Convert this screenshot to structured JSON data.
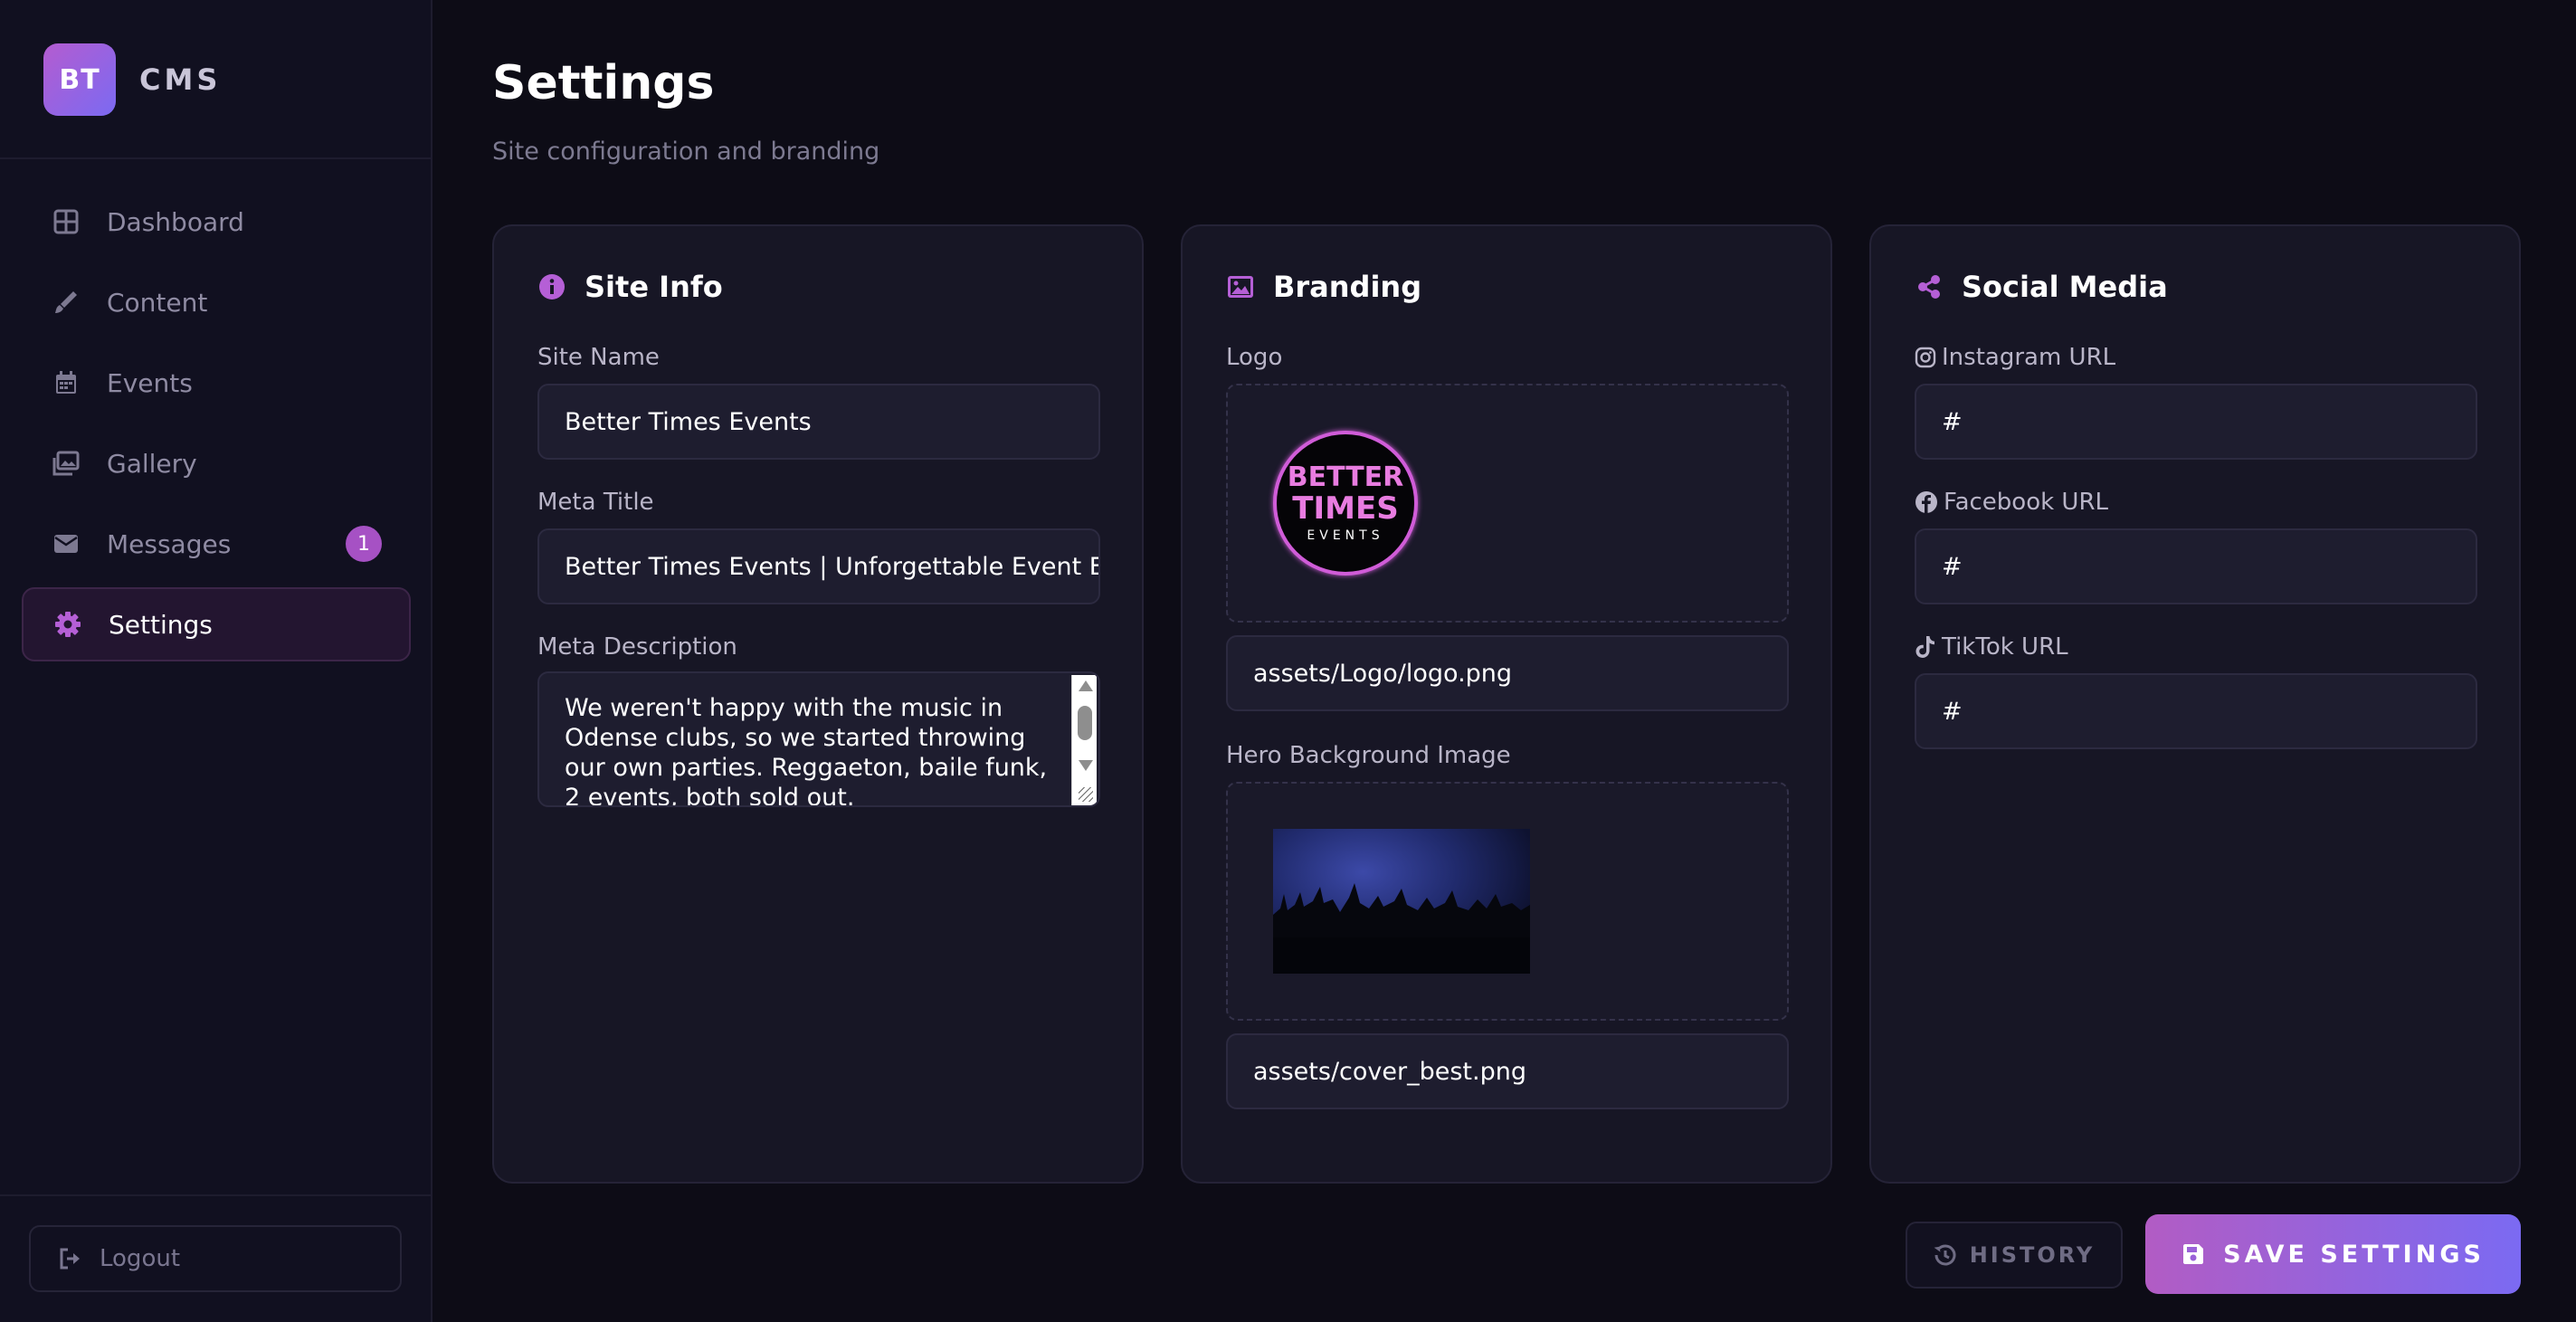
{
  "brand": {
    "badge": "BT",
    "name": "CMS"
  },
  "sidebar": {
    "items": [
      {
        "label": "Dashboard",
        "icon": "grid-icon"
      },
      {
        "label": "Content",
        "icon": "pen-icon"
      },
      {
        "label": "Events",
        "icon": "calendar-icon"
      },
      {
        "label": "Gallery",
        "icon": "images-icon"
      },
      {
        "label": "Messages",
        "icon": "envelope-icon",
        "badge": "1"
      },
      {
        "label": "Settings",
        "icon": "gear-icon",
        "active": true
      }
    ],
    "logout_label": "Logout"
  },
  "header": {
    "title": "Settings",
    "subtitle": "Site configuration and branding"
  },
  "site_info": {
    "title": "Site Info",
    "site_name_label": "Site Name",
    "site_name_value": "Better Times Events",
    "meta_title_label": "Meta Title",
    "meta_title_value": "Better Times Events | Unforgettable Event E",
    "meta_description_label": "Meta Description",
    "meta_description_value": "We weren't happy with the music in Odense clubs, so we started throwing our own parties. Reggaeton, baile funk, 2 events, both sold out."
  },
  "branding": {
    "title": "Branding",
    "logo_label": "Logo",
    "logo_text": {
      "line1": "BETTER",
      "line2": "TIMES",
      "line3": "EVENTS"
    },
    "logo_path": "assets/Logo/logo.png",
    "hero_label": "Hero Background Image",
    "hero_path": "assets/cover_best.png"
  },
  "social": {
    "title": "Social Media",
    "instagram_label": "Instagram URL",
    "instagram_value": "#",
    "facebook_label": "Facebook URL",
    "facebook_value": "#",
    "tiktok_label": "TikTok URL",
    "tiktok_value": "#"
  },
  "actions": {
    "history_label": "HISTORY",
    "save_label": "SAVE SETTINGS"
  },
  "colors": {
    "accent": "#a651c4",
    "gradient_start": "#b25cc4",
    "gradient_end": "#7b6af2",
    "background": "#0d0c16",
    "card": "#171625"
  }
}
